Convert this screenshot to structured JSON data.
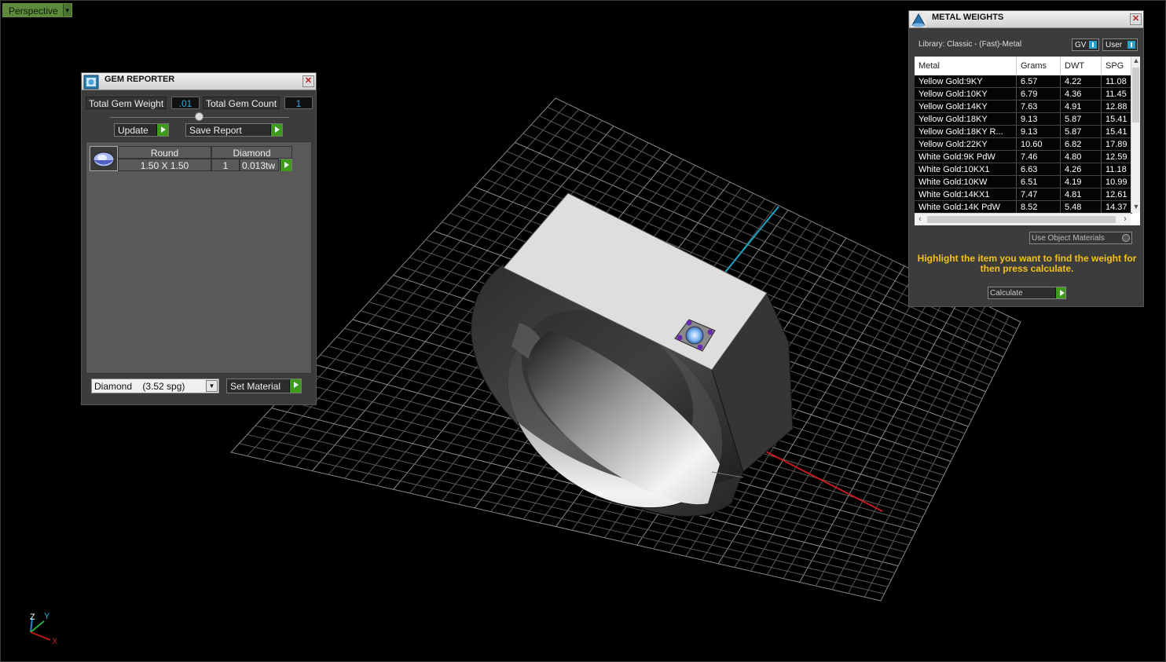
{
  "viewport": {
    "view_mode": "Perspective"
  },
  "gem_reporter": {
    "title": "GEM REPORTER",
    "total_weight_label": "Total Gem Weight",
    "total_weight_value": ".01",
    "total_count_label": "Total Gem Count",
    "total_count_value": "1",
    "update_label": "Update",
    "save_label": "Save Report",
    "gem": {
      "shape": "Round",
      "material": "Diamond",
      "size": "1.50 X 1.50",
      "count": "1",
      "weight": "0.013tw"
    },
    "material_select": "Diamond    (3.52 spg)",
    "set_material_label": "Set Material"
  },
  "metal_weights": {
    "title": "METAL WEIGHTS",
    "library": "Library: Classic - (Fast)-Metal",
    "gv_label": "GV",
    "user_label": "User",
    "columns": [
      "Metal",
      "Grams",
      "DWT",
      "SPG"
    ],
    "rows": [
      [
        "Yellow Gold:9KY",
        "6.57",
        "4.22",
        "11.08"
      ],
      [
        "Yellow Gold:10KY",
        "6.79",
        "4.36",
        "11.45"
      ],
      [
        "Yellow Gold:14KY",
        "7.63",
        "4.91",
        "12.88"
      ],
      [
        "Yellow Gold:18KY",
        "9.13",
        "5.87",
        "15.41"
      ],
      [
        "Yellow Gold:18KY R...",
        "9.13",
        "5.87",
        "15.41"
      ],
      [
        "Yellow Gold:22KY",
        "10.60",
        "6.82",
        "17.89"
      ],
      [
        "White Gold:9K PdW",
        "7.46",
        "4.80",
        "12.59"
      ],
      [
        "White Gold:10KX1",
        "6.63",
        "4.26",
        "11.18"
      ],
      [
        "White Gold:10KW",
        "6.51",
        "4.19",
        "10.99"
      ],
      [
        "White Gold:14KX1",
        "7.47",
        "4.81",
        "12.61"
      ],
      [
        "White Gold:14K PdW",
        "8.52",
        "5.48",
        "14.37"
      ]
    ],
    "use_object_label": "Use Object Materials",
    "hint": "Highlight the item you want to find the weight for then press calculate.",
    "calculate_label": "Calculate"
  },
  "axis": {
    "z": "Z",
    "y": "Y",
    "x": "X"
  },
  "colors": {
    "accent_green": "#3e9a1a",
    "hint_yellow": "#f2c21a",
    "value_blue": "#2ea9d8"
  }
}
